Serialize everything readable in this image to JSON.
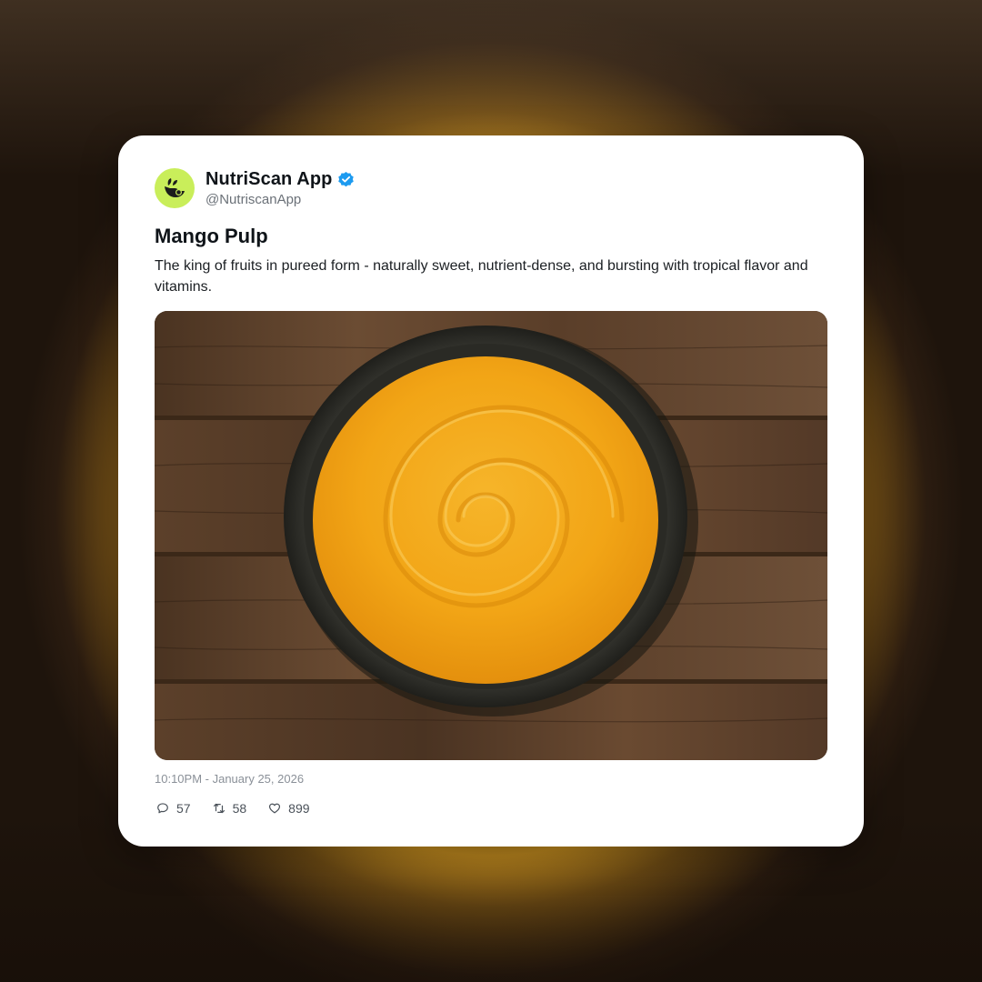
{
  "post": {
    "author_name": "NutriScan App",
    "handle": "@NutriscanApp",
    "verified": true,
    "title": "Mango Pulp",
    "text": "The king of fruits in pureed form - naturally sweet, nutrient-dense, and bursting with tropical flavor and vitamins.",
    "timestamp": "10:10PM - January 25, 2026",
    "image_icon": "mango-pulp-bowl-photo"
  },
  "stats": {
    "replies": "57",
    "reposts": "58",
    "likes": "899"
  },
  "icons": {
    "reply": "comment-icon",
    "repost": "repost-icon",
    "like": "heart-icon",
    "verified": "verified-badge-icon",
    "avatar": "nutriscan-logo-icon"
  },
  "colors": {
    "avatar_bg": "#c9ee5a",
    "verified_blue": "#1d9bf0",
    "pulp_orange": "#f2a516"
  }
}
